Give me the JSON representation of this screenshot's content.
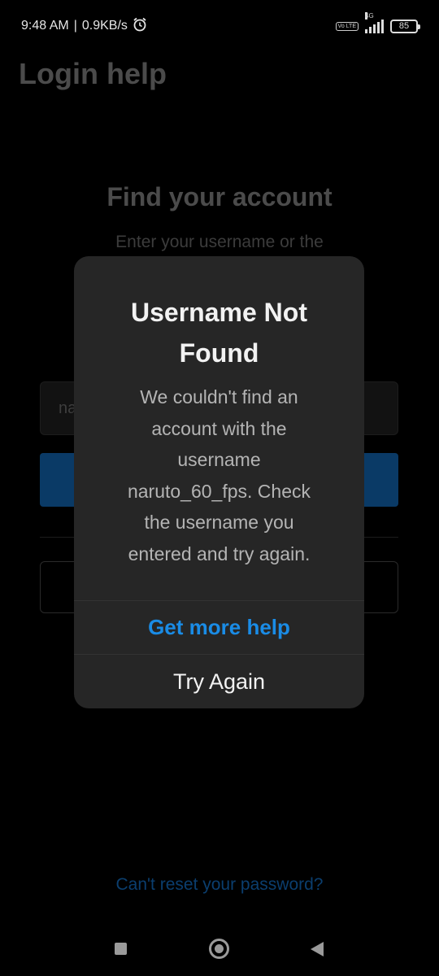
{
  "status_bar": {
    "time": "9:48 AM",
    "separator": "|",
    "speed": "0.9KB/s",
    "alarm_icon": "alarm-clock-icon",
    "volte": "Vo LTE",
    "network": "4G",
    "battery": "85"
  },
  "background_page": {
    "title": "Login help",
    "find_title": "Find your account",
    "find_subtitle": "Enter your username or the",
    "username_value_partial": "na"
  },
  "dialog": {
    "title": "Username Not Found",
    "message": "We couldn't find an account with the username naruto_60_fps. Check the username you entered and try again.",
    "get_help_label": "Get more help",
    "try_again_label": "Try Again",
    "accent_color": "#1a8ce6"
  },
  "footer": {
    "cant_reset": "Can't reset your password?"
  }
}
